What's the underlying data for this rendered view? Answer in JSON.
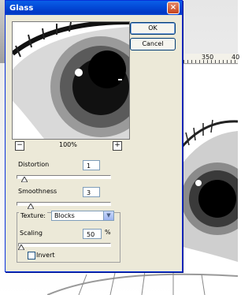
{
  "window": {
    "title": "Glass"
  },
  "buttons": {
    "ok": "OK",
    "cancel": "Cancel"
  },
  "preview": {
    "zoom_level": "100%",
    "zoom_out": "−",
    "zoom_in": "+"
  },
  "controls": {
    "distortion": {
      "label": "Distortion",
      "value": "1",
      "slider_fraction": 0.05
    },
    "smoothness": {
      "label": "Smoothness",
      "value": "3",
      "slider_fraction": 0.13
    },
    "texture": {
      "label": "Texture:",
      "selected": "Blocks"
    },
    "scaling": {
      "label": "Scaling",
      "value": "50",
      "unit": "%",
      "slider_fraction": 0.0
    },
    "invert": {
      "label": "Invert",
      "checked": false
    }
  },
  "background": {
    "ruler_ticks": [
      "350",
      "40"
    ]
  },
  "colors": {
    "titlebar": "#0349d7",
    "dialog_face": "#ece9d8",
    "close_button": "#c8451b"
  }
}
